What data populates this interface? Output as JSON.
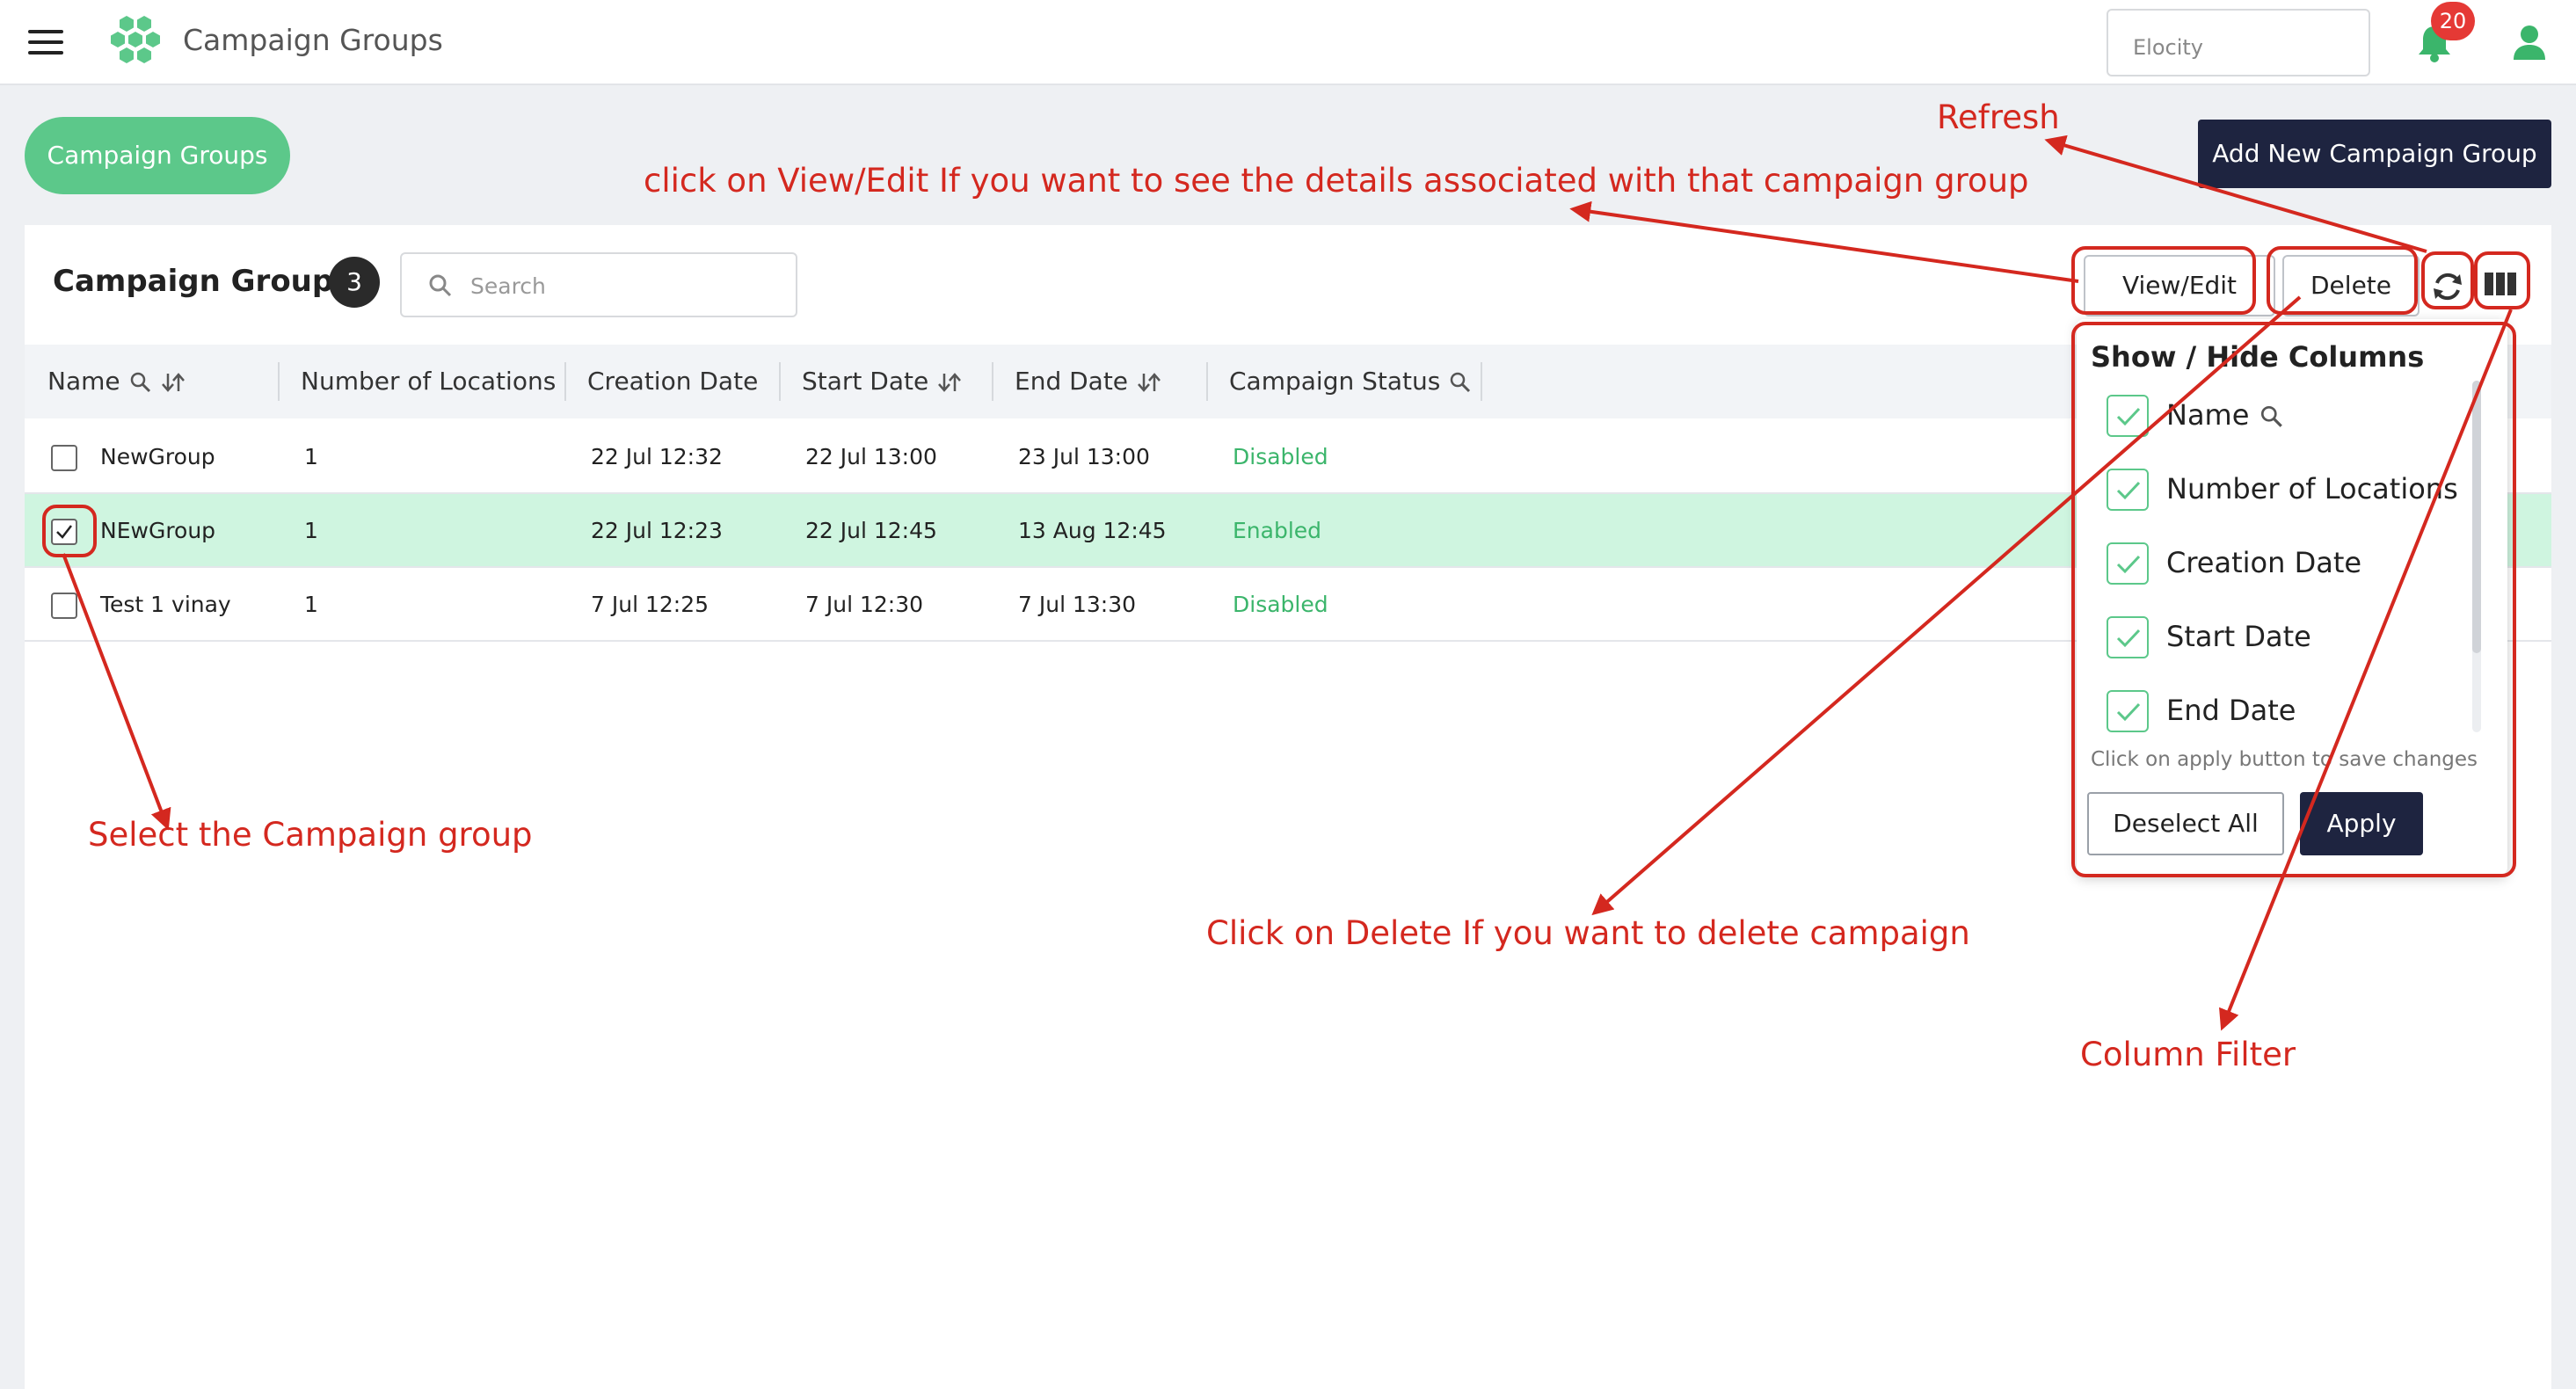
{
  "header": {
    "app_title": "Campaign Groups",
    "org_placeholder": "Elocity",
    "notification_count": "20"
  },
  "page": {
    "pill_label": "Campaign Groups",
    "add_button_label": "Add New Campaign Group"
  },
  "card": {
    "title": "Campaign Groups",
    "count": "3",
    "search_placeholder": "Search",
    "view_edit_label": "View/Edit",
    "delete_label": "Delete"
  },
  "table": {
    "columns": {
      "name": "Name",
      "locations": "Number of Locations",
      "creation": "Creation Date",
      "start": "Start Date",
      "end": "End Date",
      "status": "Campaign Status"
    },
    "rows": [
      {
        "name": "NewGroup",
        "locations": "1",
        "creation": "22 Jul 12:32",
        "start": "22 Jul 13:00",
        "end": "23 Jul 13:00",
        "status": "Disabled",
        "selected": false
      },
      {
        "name": "NEwGroup",
        "locations": "1",
        "creation": "22 Jul 12:23",
        "start": "22 Jul 12:45",
        "end": "13 Aug 12:45",
        "status": "Enabled",
        "selected": true
      },
      {
        "name": "Test 1 vinay",
        "locations": "1",
        "creation": "7 Jul 12:25",
        "start": "7 Jul 12:30",
        "end": "7 Jul 13:30",
        "status": "Disabled",
        "selected": false
      }
    ]
  },
  "column_panel": {
    "title": "Show / Hide Columns",
    "items": [
      "Name",
      "Number of Locations",
      "Creation Date",
      "Start Date",
      "End Date"
    ],
    "hint": "Click on apply button to save changes",
    "deselect_label": "Deselect All",
    "apply_label": "Apply"
  },
  "annotations": {
    "refresh": "Refresh",
    "view_edit": "click on View/Edit If you want to see the details associated with that campaign group",
    "select": "Select the Campaign group",
    "delete": "Click on Delete If you want to delete campaign",
    "column_filter": "Column Filter"
  },
  "colors": {
    "accent_green": "#5cc88a",
    "primary_dark": "#1e2440",
    "annotation_red": "#d4281f",
    "selected_row": "#cff5e0",
    "status_green": "#3bb56b"
  }
}
